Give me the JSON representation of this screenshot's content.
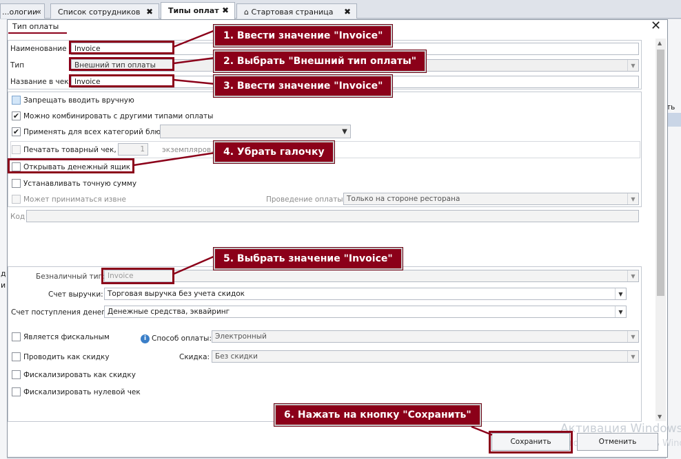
{
  "tabs": [
    {
      "label": "...ологии",
      "close": "«"
    },
    {
      "label": "Список сотрудников",
      "close": "✖"
    },
    {
      "label": "Типы оплат",
      "close": "✖"
    },
    {
      "label": "Стартовая страница",
      "close": "✖"
    }
  ],
  "background": {
    "right_label": "ть ...",
    "left_labels": [
      "д",
      "и"
    ]
  },
  "dialog": {
    "title": "Тип оплаты",
    "close": "✕"
  },
  "form": {
    "name_label": "Наименование",
    "name_value": "Invoice",
    "type_label": "Тип",
    "type_value": "Внешний тип оплаты",
    "receipt_label": "Название в чеке",
    "receipt_value": "Invoice",
    "cb_manual": "Запрещать вводить вручную",
    "cb_combine": "Можно комбинировать с другими типами оплаты",
    "cb_all_categories": "Применять для всех категорий блюд",
    "cb_print": "Печатать товарный чек,",
    "copies_value": "1",
    "copies_suffix": "экземпляров.",
    "cb_drawer": "Открывать денежный ящик",
    "cb_exact": "Устанавливать точную сумму",
    "cb_external": "Может приниматься извне",
    "posting_label": "Проведение оплаты:",
    "posting_value": "Только на стороне ресторана",
    "code_label": "Код",
    "cashless_label": "Безналичный тип:",
    "cashless_value": "Invoice",
    "revenue_label": "Счет выручки:",
    "revenue_value": "Торговая выручка без учета скидок",
    "income_label": "Счет поступления денег:",
    "income_value": "Денежные средства, эквайринг",
    "cb_fiscal": "Является фискальным",
    "method_label": "Способ оплаты:",
    "method_value": "Электронный",
    "cb_discount": "Проводить как скидку",
    "discount_label": "Скидка:",
    "discount_value": "Без скидки",
    "cb_fiscal_discount": "Фискализировать как скидку",
    "cb_fiscal_zero": "Фискализировать нулевой чек",
    "ellipsis": "…"
  },
  "buttons": {
    "save": "Сохранить",
    "cancel": "Отменить"
  },
  "callouts": [
    "1. Ввести значение \"Invoice\"",
    "2. Выбрать \"Внешний тип оплаты\"",
    "3. Ввести значение \"Invoice\"",
    "4. Убрать галочку",
    "5. Выбрать значение \"Invoice\"",
    "6. Нажать на кнопку \"Сохранить\""
  ],
  "watermark": {
    "line1": "Активация Windows",
    "line2": "Чтобы активировать Windo"
  },
  "colors": {
    "accent": "#8b0019",
    "info": "#3b7fc8"
  },
  "icons": {
    "check": "✔",
    "dropdown": "▼",
    "home": "⌂"
  }
}
